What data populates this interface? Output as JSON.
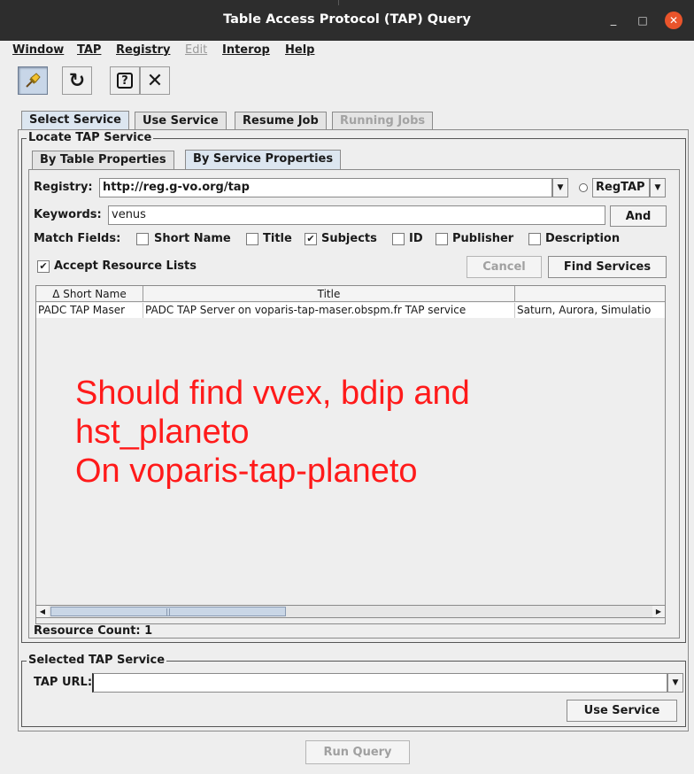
{
  "window": {
    "title": "Table Access Protocol (TAP) Query",
    "minimize": "_",
    "maximize": "□",
    "close": "✕"
  },
  "menu": [
    {
      "label": "Window",
      "enabled": true
    },
    {
      "label": "TAP",
      "enabled": true
    },
    {
      "label": "Registry",
      "enabled": true
    },
    {
      "label": "Edit",
      "enabled": false
    },
    {
      "label": "Interop",
      "enabled": true
    },
    {
      "label": "Help",
      "enabled": true
    }
  ],
  "toolbar": [
    {
      "name": "pin",
      "icon": "pin-icon",
      "glyph": "📌"
    },
    {
      "name": "reload",
      "icon": "reload-icon",
      "glyph": "↻"
    },
    {
      "name": "help",
      "icon": "help-icon",
      "glyph": "?"
    },
    {
      "name": "close",
      "icon": "close-icon",
      "glyph": "✕"
    }
  ],
  "main_tabs": [
    {
      "label": "Select Service",
      "selected": true,
      "enabled": true
    },
    {
      "label": "Use Service",
      "selected": false,
      "enabled": true
    },
    {
      "label": "Resume Job",
      "selected": false,
      "enabled": true
    },
    {
      "label": "Running Jobs",
      "selected": false,
      "enabled": false
    }
  ],
  "locate": {
    "title": "Locate TAP Service",
    "tabs": [
      {
        "label": "By Table Properties",
        "selected": false
      },
      {
        "label": "By Service Properties",
        "selected": true
      }
    ],
    "registry_label": "Registry:",
    "registry_value": "http://reg.g-vo.org/tap",
    "protocol_value": "RegTAP",
    "keywords_label": "Keywords:",
    "keywords_value": "venus",
    "and_label": "And",
    "match_label": "Match Fields:",
    "match_fields": [
      {
        "label": "Short Name",
        "checked": false
      },
      {
        "label": "Title",
        "checked": false
      },
      {
        "label": "Subjects",
        "checked": true
      },
      {
        "label": "ID",
        "checked": false
      },
      {
        "label": "Publisher",
        "checked": false
      },
      {
        "label": "Description",
        "checked": false
      }
    ],
    "accept_label": "Accept Resource Lists",
    "accept_checked": true,
    "cancel_label": "Cancel",
    "find_label": "Find Services",
    "table": {
      "columns": [
        "Δ Short Name",
        "Title",
        ""
      ],
      "rows": [
        [
          "PADC TAP Maser",
          "PADC TAP Server on voparis-tap-maser.obspm.fr TAP service",
          "Saturn, Aurora, Simulatio"
        ]
      ]
    },
    "resource_count": "Resource Count: 1"
  },
  "selected": {
    "title": "Selected TAP Service",
    "url_label": "TAP URL:",
    "url_value": "",
    "use_label": "Use Service"
  },
  "run_label": "Run Query",
  "annotation": {
    "line1": "Should find vvex, bdip and",
    "line2": "hst_planeto",
    "line3": "On voparis-tap-planeto",
    "color": "#ff1a1a"
  }
}
